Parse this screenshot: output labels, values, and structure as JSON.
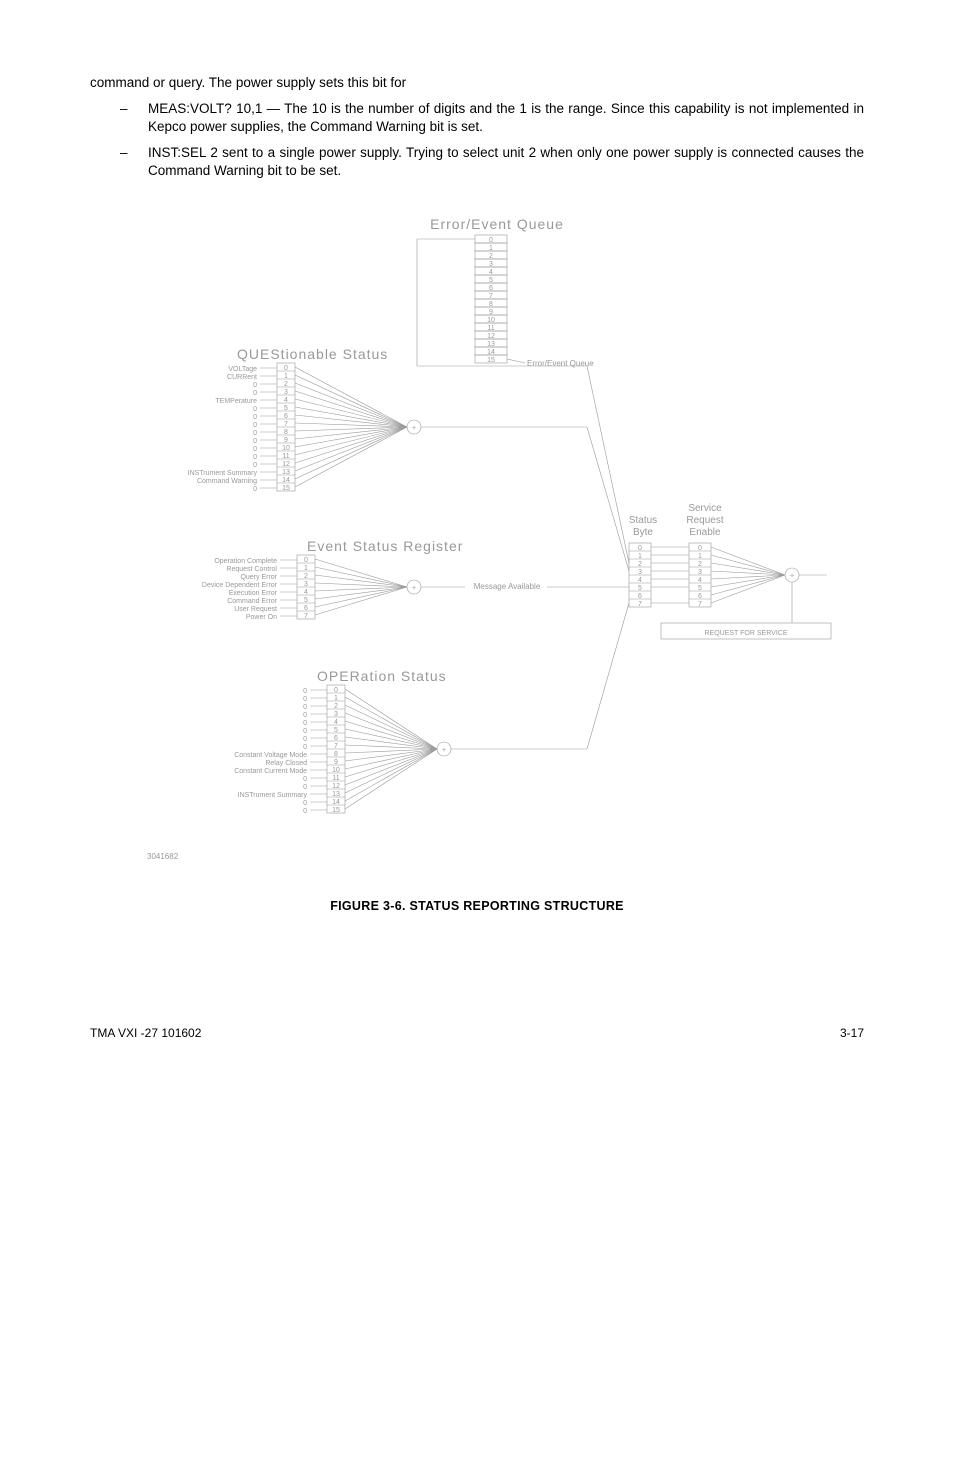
{
  "intro": "command or query.  The power supply sets this bit for",
  "bullets": [
    "MEAS:VOLT? 10,1 — The 10 is the number of digits and the 1 is the range. Since this capability is not implemented in Kepco power supplies, the Command Warning bit is set.",
    "INST:SEL 2 sent to a single power supply. Trying to select unit 2 when only one power supply is connected causes the Command Warning bit to be set."
  ],
  "figure": {
    "caption": "FIGURE 3-6.    STATUS REPORTING STRUCTURE",
    "refnum": "3041682",
    "titles": {
      "error_queue": "Error/Event Queue",
      "questionable": "QUEStionable Status",
      "event_status": "Event Status Register",
      "operation": "OPERation Status",
      "status_byte": "Status\nByte",
      "srq_enable": "Service\nRequest\nEnable",
      "req_for_service": "REQUEST FOR SERVICE",
      "message_available": "Message Available",
      "error_event_queue_lbl": "Error/Event Queue"
    },
    "questionable_labels": [
      "VOLTage",
      "CURRent",
      "0",
      "0",
      "TEMPerature",
      "0",
      "0",
      "0",
      "0",
      "0",
      "0",
      "0",
      "0",
      "INSTrument Summary",
      "Command Warning",
      "0"
    ],
    "event_status_labels": [
      "Operation Complete",
      "Request Control",
      "Query Error",
      "Device Dependent Error",
      "Execution Error",
      "Command Error",
      "User Request",
      "Power On"
    ],
    "operation_labels": [
      "0",
      "0",
      "0",
      "0",
      "0",
      "0",
      "0",
      "0",
      "Constant Voltage Mode",
      "Relay Closed",
      "Constant Current Mode",
      "0",
      "0",
      "INSTrument Summary",
      "0",
      "0"
    ]
  },
  "footer": {
    "left": "TMA VXI -27 101602",
    "right": "3-17"
  }
}
